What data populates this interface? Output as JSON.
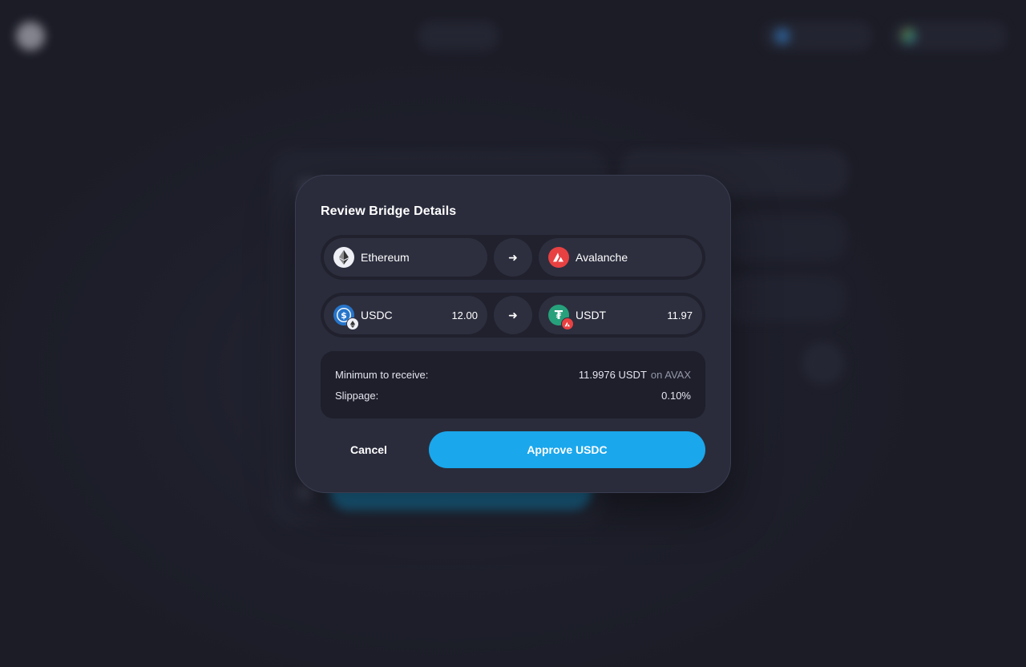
{
  "modal": {
    "title": "Review Bridge Details",
    "networks": {
      "from": {
        "name": "Ethereum",
        "icon": "ethereum-icon"
      },
      "to": {
        "name": "Avalanche",
        "icon": "avalanche-icon"
      }
    },
    "tokens": {
      "from": {
        "symbol": "USDC",
        "amount": "12.00",
        "icon": "usdc-icon",
        "network_badge": "ethereum-icon"
      },
      "to": {
        "symbol": "USDT",
        "amount": "11.97",
        "icon": "usdt-icon",
        "network_badge": "avalanche-icon"
      }
    },
    "details": {
      "min_receive_label": "Minimum to receive:",
      "min_receive_value": "11.9976 USDT",
      "min_receive_suffix": "on AVAX",
      "slippage_label": "Slippage:",
      "slippage_value": "0.10%"
    },
    "actions": {
      "cancel_label": "Cancel",
      "approve_label": "Approve USDC"
    }
  },
  "colors": {
    "accent": "#1aa7ec",
    "modal_bg": "#2a2c3c",
    "page_bg": "#1c1d28",
    "avalanche_red": "#e84142",
    "usdc_blue": "#2775ca",
    "usdt_green": "#26a17b"
  }
}
